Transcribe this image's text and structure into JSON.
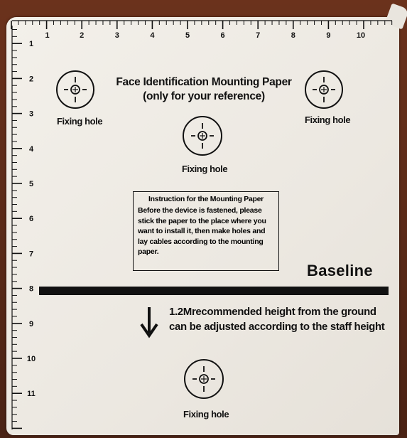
{
  "ruler": {
    "top_numbers": [
      "1",
      "2",
      "3",
      "4",
      "5",
      "6",
      "7",
      "8",
      "9",
      "10"
    ],
    "left_numbers": [
      "1",
      "2",
      "3",
      "4",
      "5",
      "6",
      "7",
      "8",
      "9",
      "10",
      "11"
    ]
  },
  "title_line1": "Face Identification Mounting Paper",
  "title_line2": "(only for your reference)",
  "holes": [
    {
      "label": "Fixing hole"
    },
    {
      "label": "Fixing hole"
    },
    {
      "label": "Fixing hole"
    },
    {
      "label": "Fixing hole"
    }
  ],
  "instruction": {
    "title": "Instruction for the Mounting Paper",
    "body": "Before the device is fastened, please stick the paper to the place where you want to install it, then make holes and lay cables according to the mounting paper."
  },
  "baseline_label": "Baseline",
  "recommend_line1": "1.2Mrecommended height from the ground",
  "recommend_line2": "can be adjusted according to the staff height",
  "colors": {
    "ink": "#111111",
    "paper": "#efebe4",
    "background": "#5a2a18"
  }
}
